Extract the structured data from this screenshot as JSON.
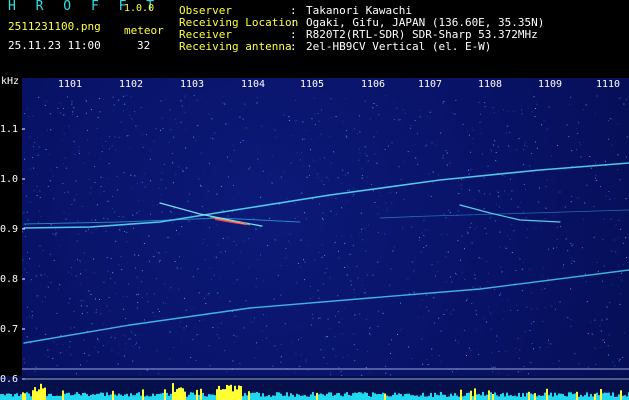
{
  "header": {
    "app_title": "H R O F F T",
    "app_version": "1.0.0",
    "file_name": "2511231100.png",
    "datetime": "25.11.23 11:00",
    "meteor_label": "meteor",
    "meteor_count": "32",
    "info": [
      {
        "label": "Observer",
        "value": "Takanori Kawachi"
      },
      {
        "label": "Receiving Location",
        "value": "Ogaki, Gifu, JAPAN (136.60E, 35.35N)"
      },
      {
        "label": "Receiver",
        "value": "R820T2(RTL-SDR) SDR-Sharp 53.372MHz"
      },
      {
        "label": "Receiving antenna",
        "value": "2el-HB9CV Vertical (el. E-W)"
      }
    ]
  },
  "axes": {
    "y_unit": "kHz",
    "y_ticks": [
      "1.1",
      "1.0",
      "0.9",
      "0.8",
      "0.7",
      "0.6"
    ],
    "x_ticks": [
      "1101",
      "1102",
      "1103",
      "1104",
      "1105",
      "1106",
      "1107",
      "1108",
      "1109",
      "1110"
    ]
  },
  "colors": {
    "text_cyan": "#33e0e0",
    "text_yellow": "#ffff44",
    "background_plot": "#081266",
    "trail": "#5fe6ff",
    "hot": "#ff4060",
    "echo_bar": "#ffff33",
    "noise_floor": "#22d8f0"
  }
}
